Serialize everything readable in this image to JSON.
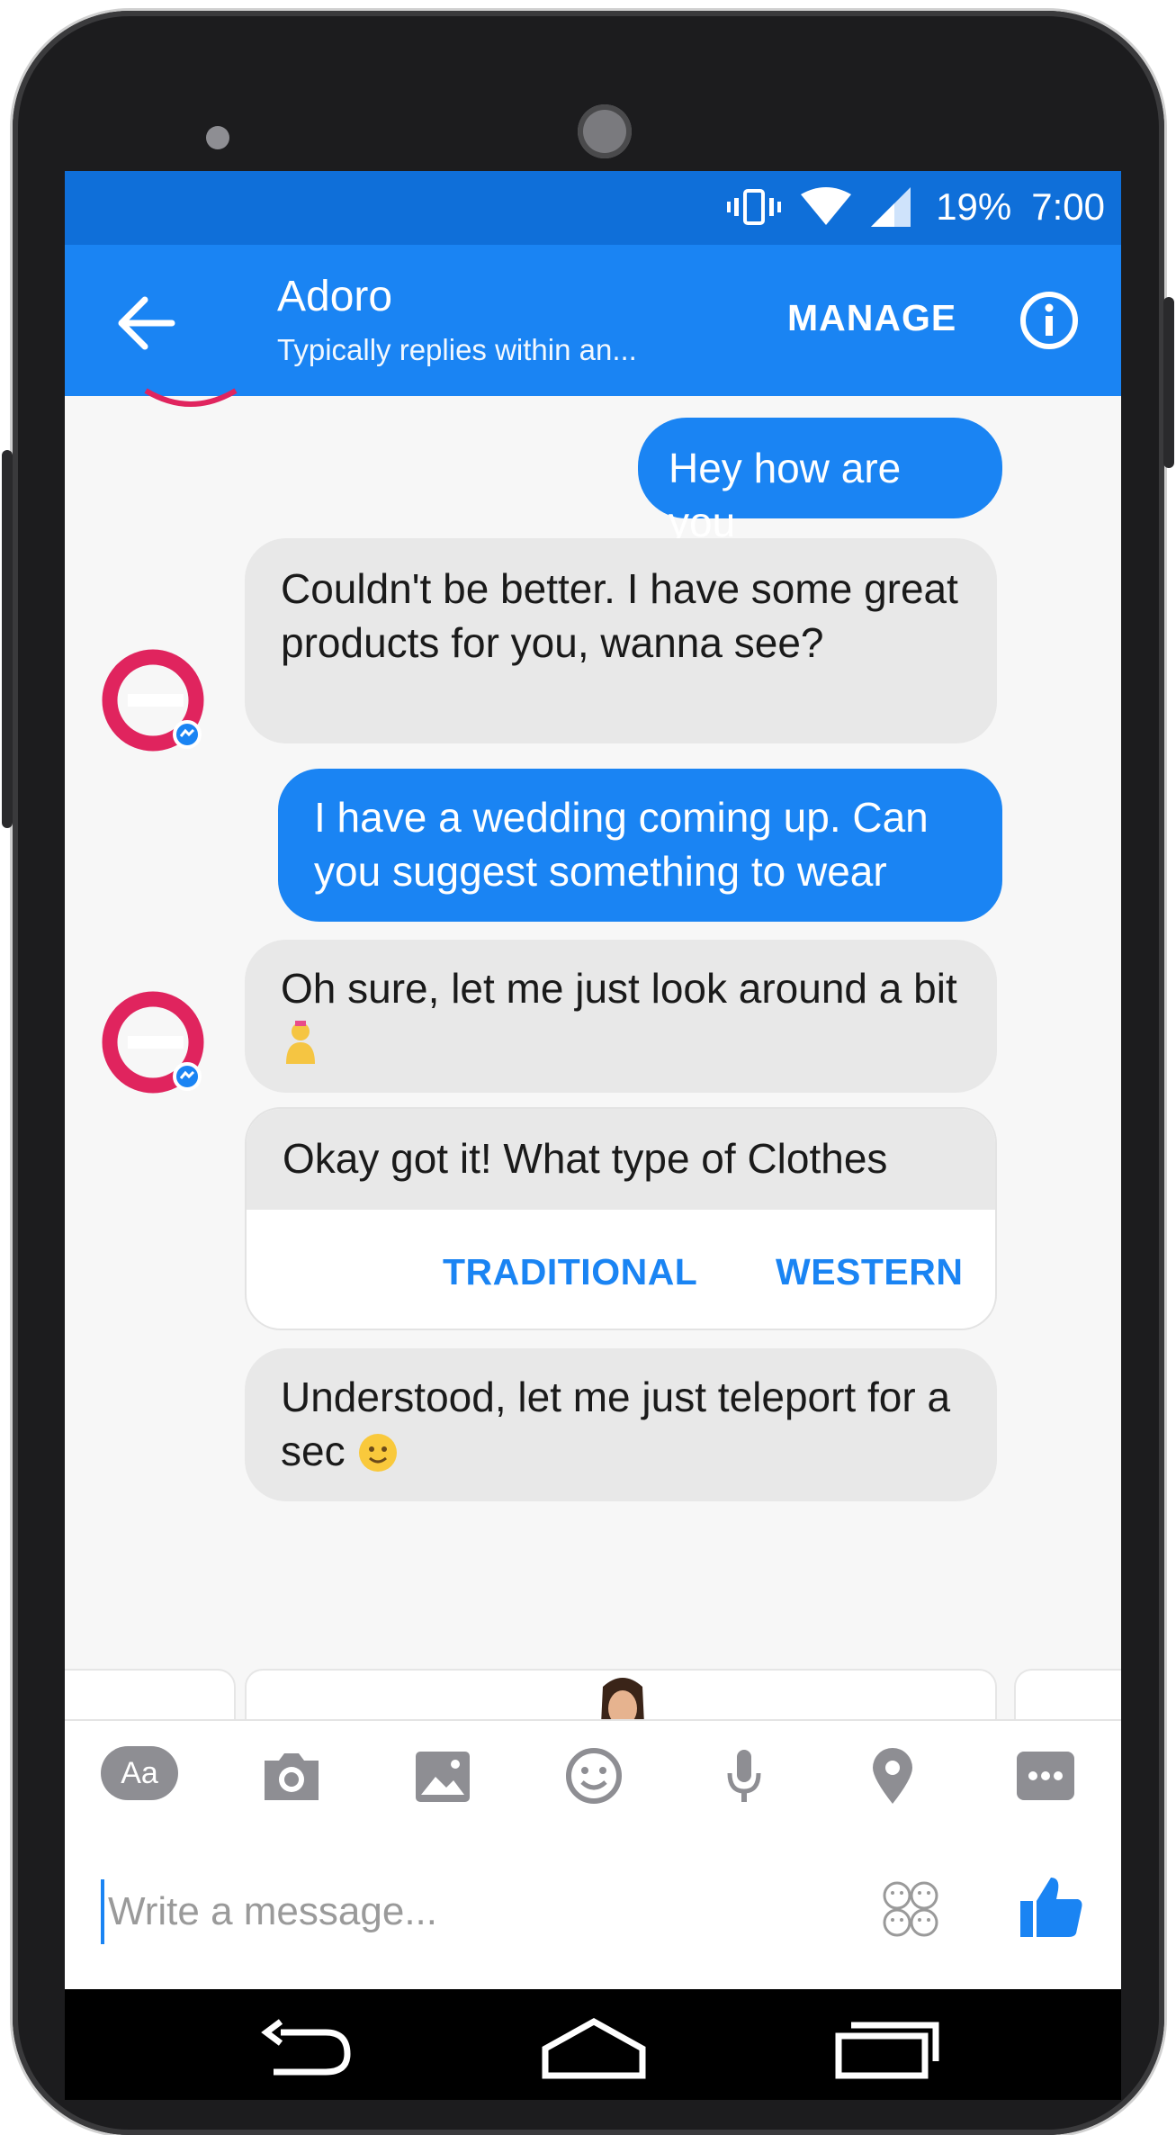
{
  "status_bar": {
    "battery": "19%",
    "time": "7:00"
  },
  "app_bar": {
    "title": "Adoro",
    "subtitle": "Typically replies within an...",
    "manage_label": "MANAGE"
  },
  "messages": [
    {
      "from": "me",
      "text": "Hey how are you"
    },
    {
      "from": "bot",
      "text": "Couldn't be better. I have some great products for you, wanna see?"
    },
    {
      "from": "me",
      "text": "I have a wedding coming up. Can you suggest something to wear"
    },
    {
      "from": "bot",
      "text": "Oh sure, let me just look around a bit"
    },
    {
      "from": "bot",
      "text": "Okay got it! What type of Clothes"
    },
    {
      "from": "bot",
      "text": "Understood, let me just teleport for a sec"
    }
  ],
  "quick_replies": [
    "TRADITIONAL",
    "WESTERN"
  ],
  "toolbar": {
    "icons": [
      "text-mode-icon",
      "camera-icon",
      "gallery-icon",
      "emoji-icon",
      "microphone-icon",
      "location-icon",
      "more-icon"
    ],
    "text_mode_label": "Aa"
  },
  "composer": {
    "placeholder": "Write a message..."
  },
  "colors": {
    "messenger_blue": "#1a84f3",
    "status_bar_blue": "#0f6fd9",
    "incoming_bubble": "#e8e8e8",
    "brand_pink": "#e0245e"
  }
}
